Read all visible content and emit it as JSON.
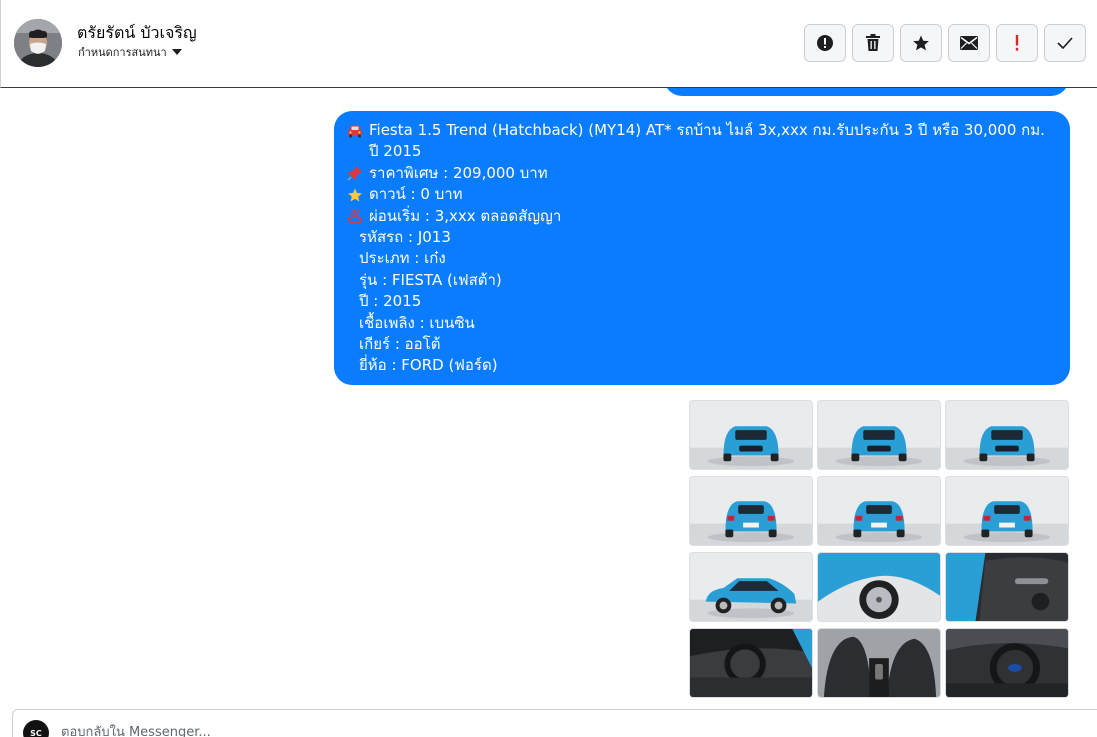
{
  "header": {
    "contact_name": "ตรัยรัตน์ บัวเจริญ",
    "assign_label": "กำหนดการสนทนา"
  },
  "message": {
    "lines": [
      {
        "icon": "car-icon",
        "text": "Fiesta 1.5 Trend (Hatchback) (MY14) AT* รถบ้าน ไมล์ 3x,xxx กม.รับประกัน 3 ปี หรือ 30,000 กม. ปี 2015"
      },
      {
        "icon": "pin-icon",
        "text": "ราคาพิเศษ : 209,000 บาท"
      },
      {
        "icon": "star-icon",
        "text": "ดาวน์ : 0 บาท"
      },
      {
        "icon": "hot-icon",
        "text": "ผ่อนเริ่ม : 3,xxx ตลอดสัญญา"
      }
    ],
    "details": [
      "รหัสรถ : J013",
      "ประเภท : เก๋ง",
      "รุ่น : FIESTA (เฟสต้า)",
      "ปี : 2015",
      "เชื้อเพลิง : เบนซิน",
      "เกียร์ : ออโต้",
      "ยี่ห้อ : FORD (ฟอร์ด)"
    ]
  },
  "photos": [
    "car-front-left",
    "car-front",
    "car-front-right",
    "car-rear-left",
    "car-rear",
    "car-rear-right",
    "car-side",
    "car-wheel",
    "car-door-interior",
    "car-dashboard",
    "car-seats",
    "car-steering"
  ],
  "composer": {
    "placeholder": "ตอบกลับใน Messenger...",
    "avatar_text": "SC"
  },
  "colors": {
    "bubble": "#0a7cff",
    "car_body": "#2a9fd6",
    "report_mark": "#e02424"
  }
}
